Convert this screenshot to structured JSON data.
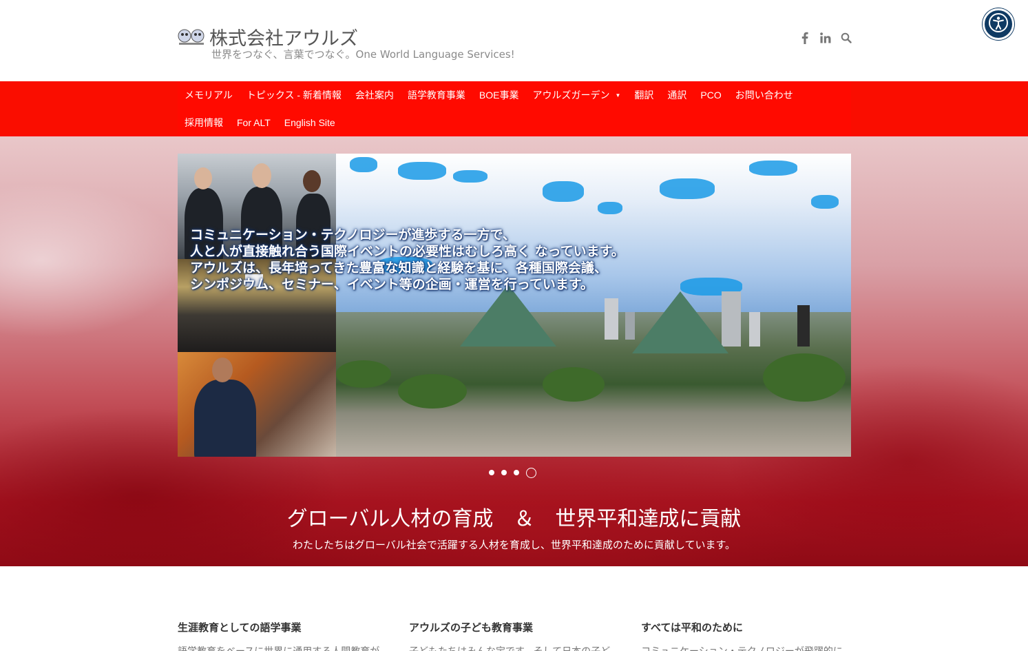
{
  "header": {
    "site_title": "株式会社アウルズ",
    "tagline": "世界をつなぐ、言葉でつなぐ。One World Language Services!"
  },
  "social": {
    "facebook_icon": "f",
    "linkedin_icon": "in",
    "search_icon": "search-icon"
  },
  "accessibility": {
    "icon": "accessibility-icon"
  },
  "nav": {
    "row1": [
      {
        "label": "メモリアル"
      },
      {
        "label": "トピックス - 新着情報"
      },
      {
        "label": "会社案内"
      },
      {
        "label": "語学教育事業"
      },
      {
        "label": "BOE事業"
      },
      {
        "label": "アウルズガーデン",
        "has_dropdown": true
      },
      {
        "label": "翻訳"
      },
      {
        "label": "通訳"
      },
      {
        "label": "PCO"
      },
      {
        "label": "お問い合わせ"
      }
    ],
    "row2": [
      {
        "label": "採用情報"
      },
      {
        "label": "For ALT"
      },
      {
        "label": "English Site"
      }
    ],
    "dropdown_caret": "▼"
  },
  "slider": {
    "text_lines": [
      "コミュニケーション・テクノロジーが進歩する一方で、",
      "人と人が直接触れ合う国際イベントの必要性はむしろ高く なっています。",
      "アウルズは、長年培ってきた豊富な知識と経験を基に、各種国際会議、",
      "シンポジウム、セミナー、イベント等の企画・運営を行っています。"
    ],
    "dots_count": 4,
    "active_index": 3
  },
  "hero": {
    "title": "グローバル人材の育成　＆　世界平和達成に貢献",
    "subtitle": "わたしたちはグローバル社会で活躍する人材を育成し、世界平和達成のために貢献しています。"
  },
  "columns": [
    {
      "title": "生涯教育としての語学事業",
      "text": "語学教育をベースに世界に通用する人間教育が"
    },
    {
      "title": "アウルズの子ども教育事業",
      "text": "子どもたちはみんな宝です。そして日本の子ど"
    },
    {
      "title": "すべては平和のために",
      "text": "コミュニケーション・テクノロジーが飛躍的に"
    }
  ],
  "colors": {
    "nav_bg": "#ff0a00",
    "accessibility_bg": "#0f3a63"
  }
}
